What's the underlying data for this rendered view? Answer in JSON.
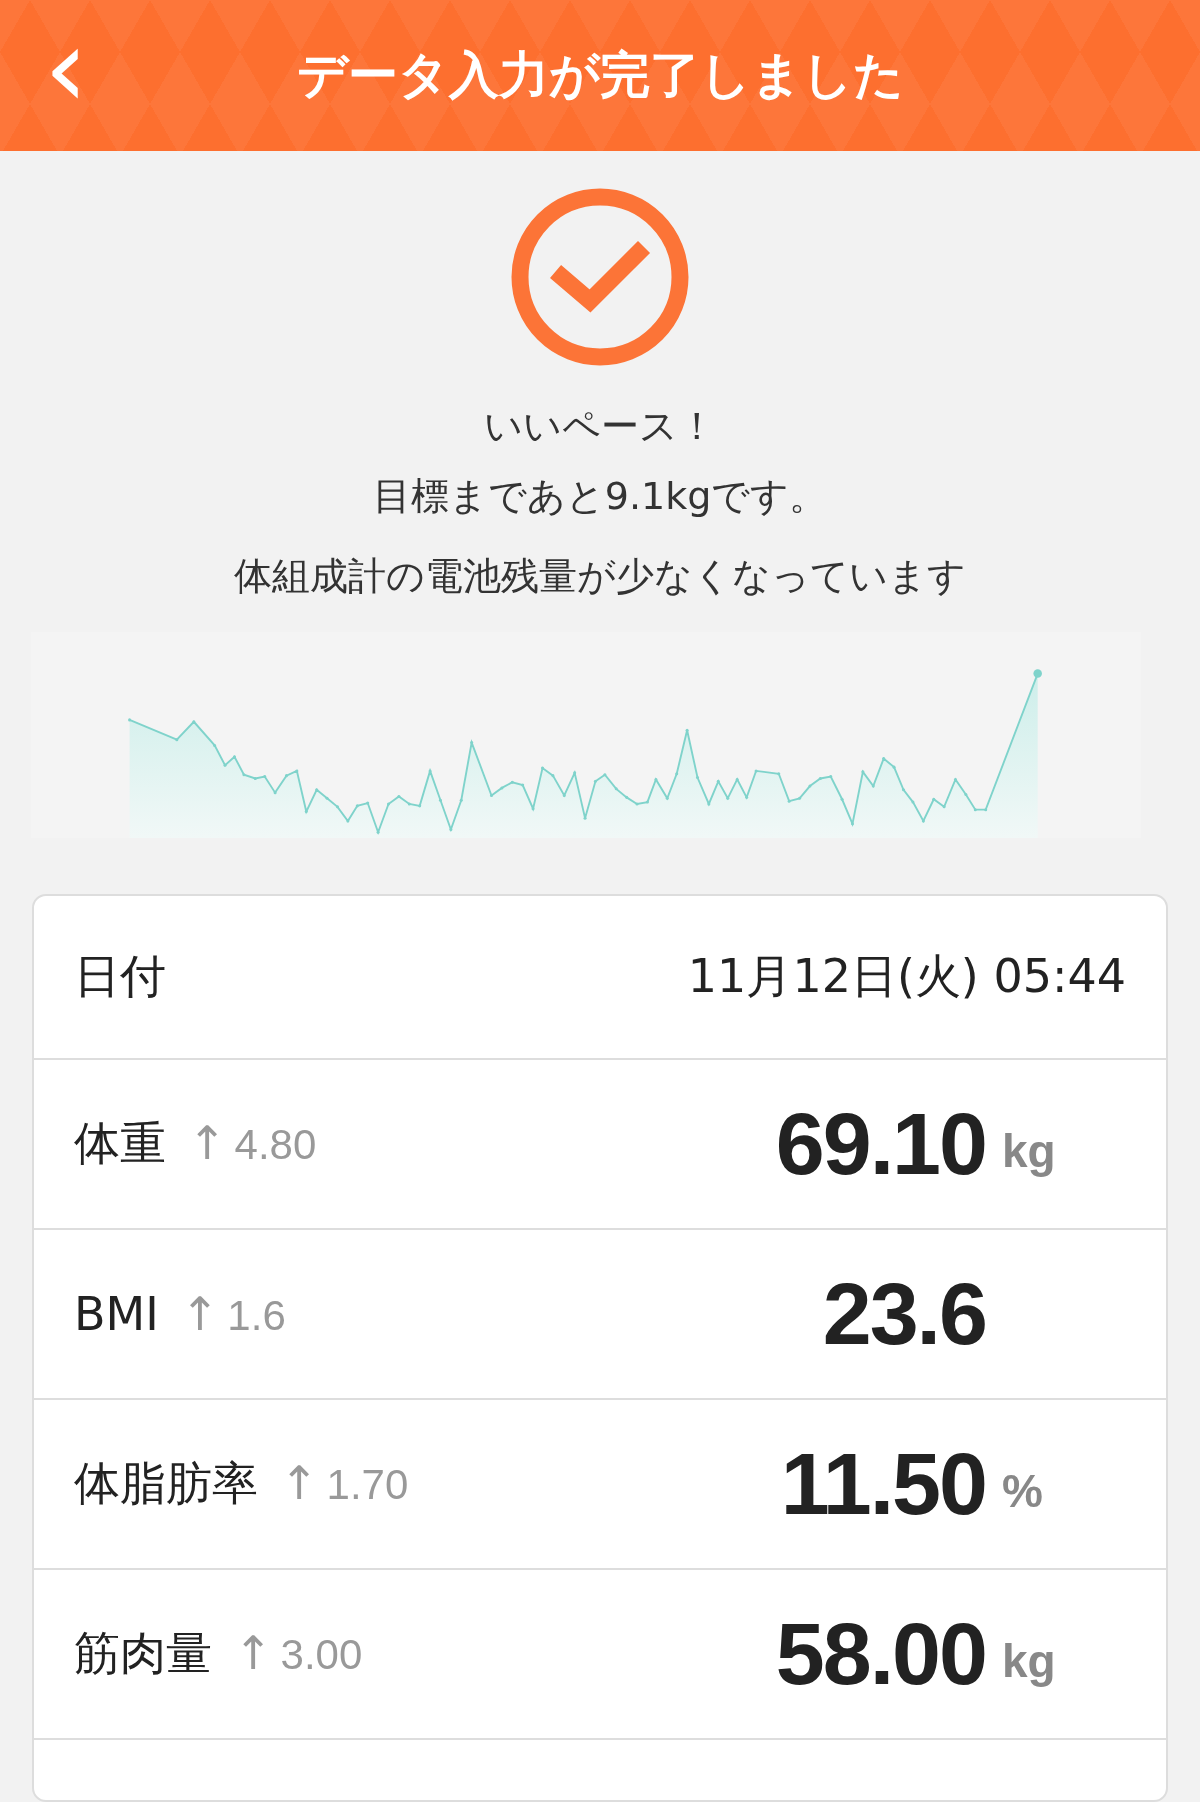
{
  "header": {
    "back_icon": "‹",
    "title": "データ入力が完了しました"
  },
  "message": {
    "lines": [
      "いいペース！",
      "目標まであと9.1kgです。"
    ],
    "notice": "体組成計の電池残量が少なくなっています"
  },
  "rows": [
    {
      "kind": "date",
      "label": "日付",
      "value": "11月12日(火) 05:44"
    },
    {
      "kind": "metric",
      "label": "体重",
      "arrow": "↑",
      "change": "4.80",
      "value": "69.10",
      "unit": "kg"
    },
    {
      "kind": "metric",
      "label": "BMI",
      "arrow": "↑",
      "change": "1.6",
      "value": "23.6"
    },
    {
      "kind": "metric",
      "label": "体脂肪率",
      "arrow": "↑",
      "change": "1.70",
      "value": "11.50",
      "unit": "%"
    },
    {
      "kind": "metric",
      "label": "筋肉量",
      "arrow": "↑",
      "change": "3.00",
      "value": "58.00",
      "unit": "kg"
    }
  ]
}
